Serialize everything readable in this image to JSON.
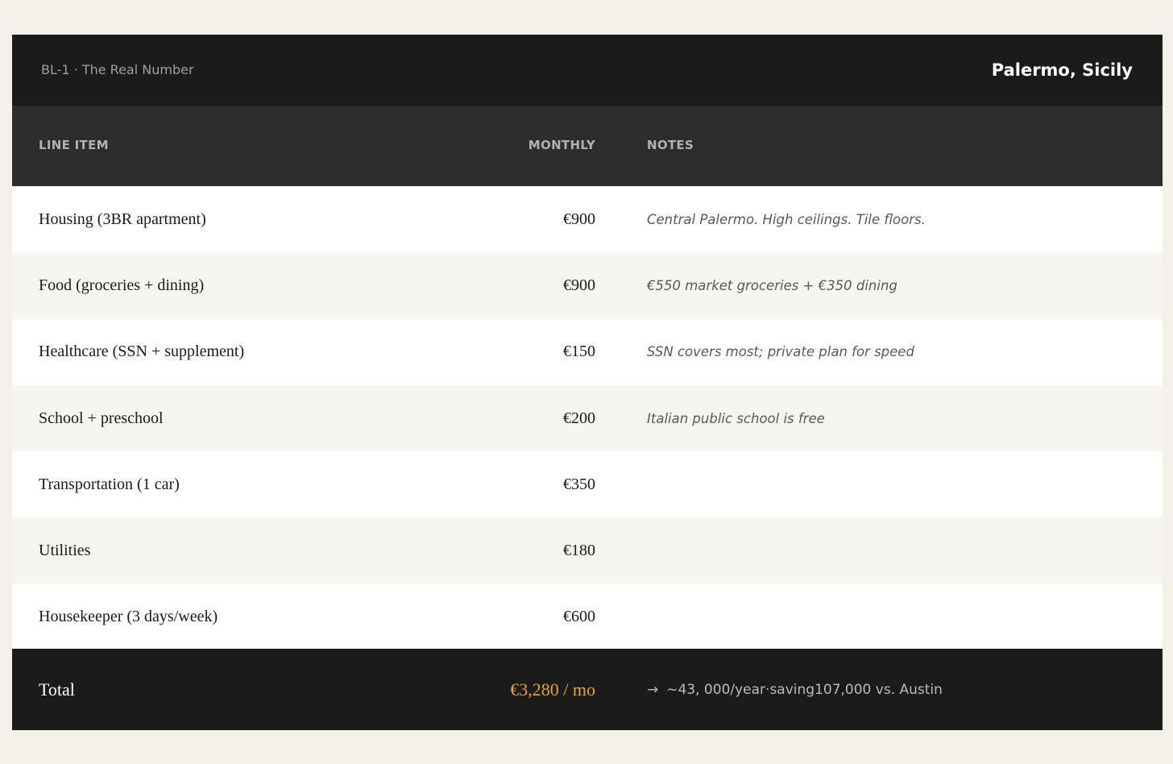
{
  "header": {
    "subtitle": "BL-1 · The Real Number",
    "city": "Palermo, Sicily"
  },
  "columns": {
    "item": "LINE ITEM",
    "monthly": "MONTHLY",
    "notes": "NOTES"
  },
  "rows": [
    {
      "item": "Housing (3BR apartment)",
      "monthly": "€900",
      "note": "Central Palermo. High ceilings. Tile floors."
    },
    {
      "item": "Food (groceries + dining)",
      "monthly": "€900",
      "note": "€550 market groceries + €350 dining"
    },
    {
      "item": "Healthcare (SSN + supplement)",
      "monthly": "€150",
      "note": "SSN covers most; private plan for speed"
    },
    {
      "item": "School + preschool",
      "monthly": "€200",
      "note": "Italian public school is free"
    },
    {
      "item": "Transportation (1 car)",
      "monthly": "€350",
      "note": ""
    },
    {
      "item": "Utilities",
      "monthly": "€180",
      "note": ""
    },
    {
      "item": "Housekeeper (3 days/week)",
      "monthly": "€600",
      "note": ""
    }
  ],
  "total": {
    "label": "Total",
    "value": "€3,280 / mo",
    "arrow": "→",
    "summary": "~43, 000/year·saving107,000 vs. Austin"
  },
  "colors": {
    "header_bg": "#1b1b1b",
    "colhead_bg": "#2d2d2d",
    "accent": "#e6a52c",
    "page_bg": "#f4f1eb"
  }
}
